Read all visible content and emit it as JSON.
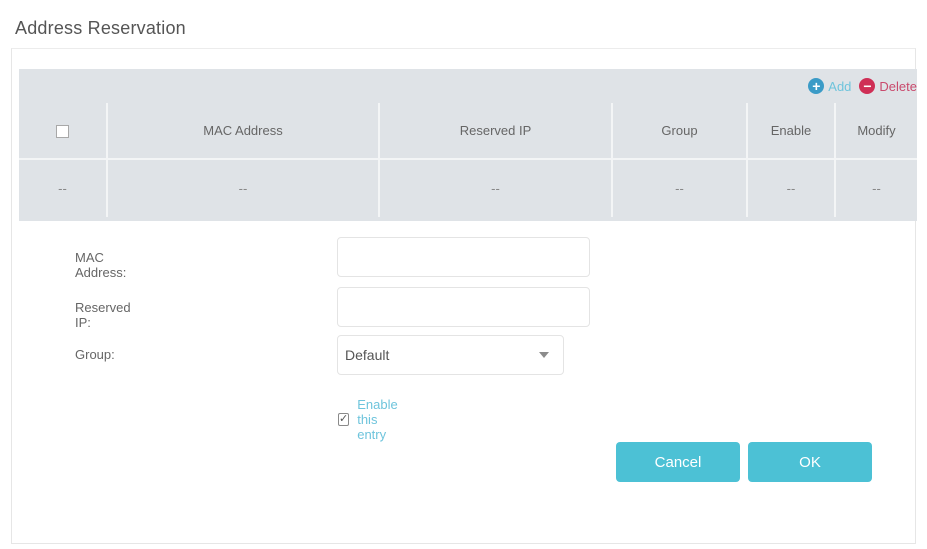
{
  "section": {
    "title": "Address Reservation"
  },
  "toolbar": {
    "add_icon": "plus-circle-icon",
    "add_label": "Add",
    "delete_icon": "minus-circle-icon",
    "delete_label": "Delete"
  },
  "table": {
    "columns": [
      "",
      "MAC Address",
      "Reserved IP",
      "Group",
      "Enable",
      "Modify"
    ],
    "rows": [
      [
        "--",
        "--",
        "--",
        "--",
        "--",
        "--"
      ]
    ]
  },
  "form": {
    "mac_label": "MAC Address:",
    "mac_value": "",
    "ip_label": "Reserved IP:",
    "ip_value": "",
    "group_label": "Group:",
    "group_selected": "Default",
    "enable_label": "Enable this entry",
    "enable_checked": true
  },
  "buttons": {
    "cancel_label": "Cancel",
    "ok_label": "OK"
  },
  "colors": {
    "accent": "#4cc1d5",
    "add": "#3b9bc7",
    "delete": "#cf2f56",
    "panel": "#dfe3e7"
  }
}
